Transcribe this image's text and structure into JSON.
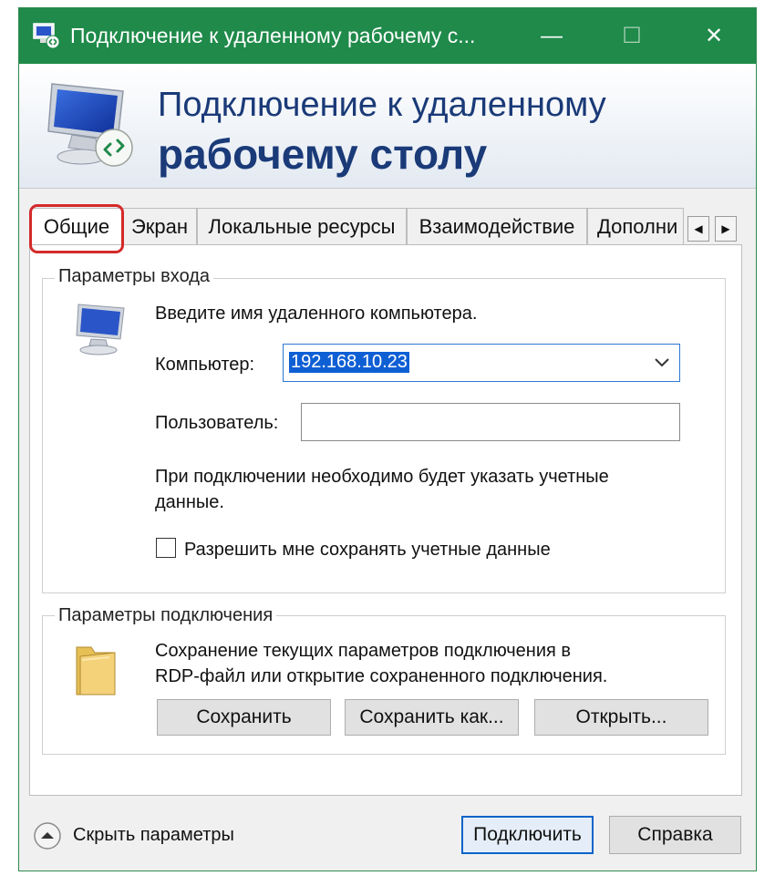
{
  "window": {
    "title": "Подключение к удаленному рабочему с...",
    "minimize": "—",
    "maximize": "☐",
    "close": "✕"
  },
  "banner": {
    "line1": "Подключение к удаленному",
    "line2": "рабочему столу"
  },
  "tabs": [
    {
      "label": "Общие",
      "active": true
    },
    {
      "label": "Экран"
    },
    {
      "label": "Локальные ресурсы"
    },
    {
      "label": "Взаимодействие"
    },
    {
      "label": "Дополни"
    }
  ],
  "tab_scroll": {
    "left": "◀",
    "right": "▶"
  },
  "login": {
    "legend": "Параметры входа",
    "instruction": "Введите имя удаленного компьютера.",
    "computer_label": "Компьютер:",
    "computer_value": "192.168.10.23",
    "user_label": "Пользователь:",
    "user_value": "",
    "note_line1": "При подключении необходимо будет указать учетные",
    "note_line2": "данные.",
    "save_creds_label": "Разрешить мне сохранять учетные данные",
    "save_creds_checked": false
  },
  "connection": {
    "legend": "Параметры подключения",
    "desc_line1": "Сохранение текущих параметров подключения в",
    "desc_line2": "RDP-файл или открытие сохраненного подключения.",
    "save": "Сохранить",
    "save_as": "Сохранить как...",
    "open": "Открыть..."
  },
  "footer": {
    "hide_options": "Скрыть параметры",
    "connect": "Подключить",
    "help": "Справка"
  },
  "colors": {
    "titlebar": "#1f8a4a",
    "banner_text": "#1a3a78",
    "selection": "#0f5fd4",
    "highlight": "#d42a2a"
  }
}
